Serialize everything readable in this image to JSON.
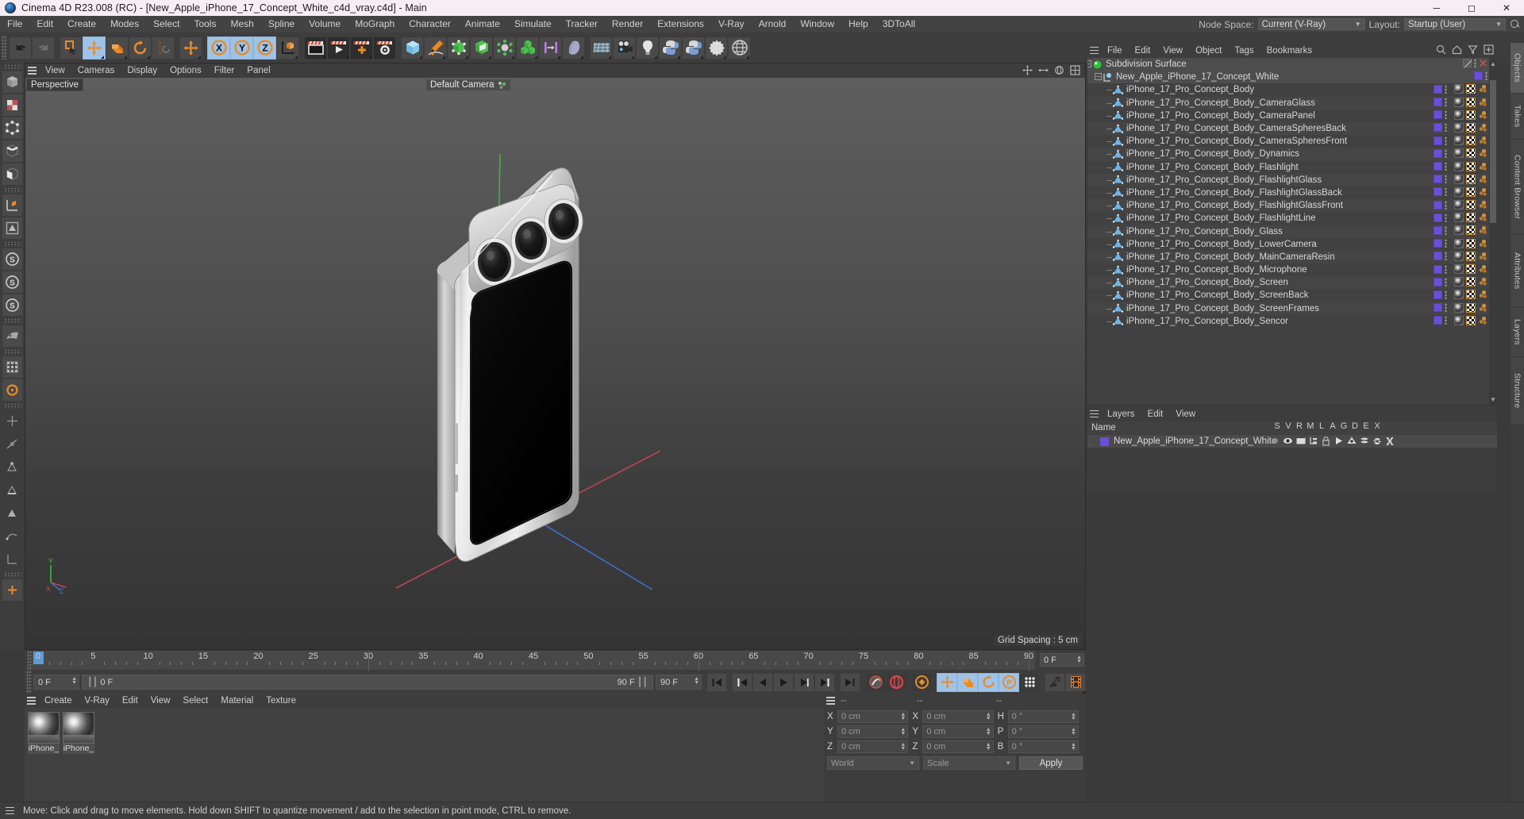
{
  "window": {
    "title": "Cinema 4D R23.008 (RC) - [New_Apple_iPhone_17_Concept_White_c4d_vray.c4d] - Main",
    "app_icon": "cinema4d-logo-icon",
    "minimize": "─",
    "maximize": "☐",
    "close": "✕"
  },
  "menubar": {
    "items": [
      "File",
      "Edit",
      "Create",
      "Modes",
      "Select",
      "Tools",
      "Mesh",
      "Spline",
      "Volume",
      "MoGraph",
      "Character",
      "Animate",
      "Simulate",
      "Tracker",
      "Render",
      "Extensions",
      "V-Ray",
      "Arnold",
      "Window",
      "Help",
      "3DToAll"
    ],
    "node_space_label": "Node Space:",
    "node_space_value": "Current (V-Ray)",
    "layout_label": "Layout:",
    "layout_value": "Startup (User)",
    "search_icon": "search-icon"
  },
  "toolbar": {
    "buttons": [
      {
        "name": "undo-button",
        "icon": "undo-icon",
        "state": "normal"
      },
      {
        "name": "redo-button",
        "icon": "redo-icon",
        "state": "disabled"
      },
      {
        "name": "live-selection-button",
        "icon": "selection-square-icon",
        "state": "normal"
      },
      {
        "name": "move-tool-button",
        "icon": "move-arrows-icon",
        "state": "active"
      },
      {
        "name": "scale-tool-button",
        "icon": "scale-box-icon",
        "state": "normal"
      },
      {
        "name": "rotate-tool-button",
        "icon": "rotate-circle-icon",
        "state": "normal"
      },
      {
        "name": "psr-button",
        "icon": "psr-icon",
        "state": "normal"
      },
      {
        "name": "world-axis-button",
        "icon": "move-arrows-icon",
        "state": "normal"
      },
      {
        "name": "x-axis-lock-button",
        "icon": "axis-x-icon",
        "state": "active"
      },
      {
        "name": "y-axis-lock-button",
        "icon": "axis-y-icon",
        "state": "active"
      },
      {
        "name": "z-axis-lock-button",
        "icon": "axis-z-icon",
        "state": "active"
      },
      {
        "name": "world-object-coord-button",
        "icon": "world-coord-icon",
        "state": "normal"
      },
      {
        "name": "render-view-button",
        "icon": "render-view-icon",
        "state": "dark"
      },
      {
        "name": "render-region-button",
        "icon": "render-region-icon",
        "state": "dark"
      },
      {
        "name": "render-queue-button",
        "icon": "render-queue-icon",
        "state": "dark"
      },
      {
        "name": "render-settings-button",
        "icon": "render-settings-icon",
        "state": "dark"
      },
      {
        "name": "cube-primitive-button",
        "icon": "cube-icon",
        "state": "normal"
      },
      {
        "name": "spline-pen-button",
        "icon": "pen-icon",
        "state": "normal"
      },
      {
        "name": "nurbs-button",
        "icon": "nurbs-icon",
        "state": "normal"
      },
      {
        "name": "array-button",
        "icon": "array-icon",
        "state": "normal"
      },
      {
        "name": "deformer-button",
        "icon": "deformer-icon",
        "state": "normal"
      },
      {
        "name": "mograph-button",
        "icon": "mograph-cubes-icon",
        "state": "normal"
      },
      {
        "name": "field-button",
        "icon": "field-icon",
        "state": "normal"
      },
      {
        "name": "hair-button",
        "icon": "hair-icon",
        "state": "normal"
      },
      {
        "name": "floor-button",
        "icon": "floor-grid-icon",
        "state": "normal"
      },
      {
        "name": "camera-button",
        "icon": "camera-icon",
        "state": "normal"
      },
      {
        "name": "light-button",
        "icon": "light-bulb-icon",
        "state": "normal"
      },
      {
        "name": "python-button",
        "icon": "python-icon",
        "state": "normal"
      },
      {
        "name": "python-generator-button",
        "icon": "python-icon",
        "state": "normal"
      },
      {
        "name": "xpresso-button",
        "icon": "gear-star-icon",
        "state": "normal"
      },
      {
        "name": "web-button",
        "icon": "globe-icon",
        "state": "normal"
      }
    ]
  },
  "left_toolbar": {
    "buttons": [
      {
        "name": "model-mode-button",
        "icon": "model-mode-icon"
      },
      {
        "name": "texture-mode-button",
        "icon": "texture-mode-icon"
      },
      {
        "name": "point-mode-button",
        "icon": "point-mode-icon"
      },
      {
        "name": "edge-mode-button",
        "icon": "edge-mode-icon"
      },
      {
        "name": "polygon-mode-button",
        "icon": "polygon-mode-icon"
      },
      {
        "name": "enable-axis-button",
        "icon": "axis-modify-icon"
      },
      {
        "name": "viewport-solo-button",
        "icon": "viewport-solo-icon"
      },
      {
        "name": "solo-single-button",
        "icon": "solo-single-icon"
      },
      {
        "name": "solo-hierarchy-button",
        "icon": "solo-hierarchy-icon"
      },
      {
        "name": "solo-off-button",
        "icon": "solo-off-icon"
      },
      {
        "name": "workplane-button",
        "icon": "workplane-icon"
      },
      {
        "name": "snap-button",
        "icon": "snap-magnet-icon"
      },
      {
        "name": "quantize-button",
        "icon": "quantize-icon"
      },
      {
        "name": "grid-snap-button",
        "icon": "grid-snap-icon"
      },
      {
        "name": "guide-snap-button",
        "icon": "guide-snap-icon"
      },
      {
        "name": "point-snap-button",
        "icon": "point-snap-icon"
      },
      {
        "name": "edge-snap-button",
        "icon": "edge-snap-icon"
      },
      {
        "name": "poly-snap-button",
        "icon": "poly-snap-icon"
      },
      {
        "name": "spline-snap-button",
        "icon": "spline-snap-icon"
      },
      {
        "name": "axis-snap-button",
        "icon": "axis-snap-icon"
      }
    ]
  },
  "viewport": {
    "menu": [
      "View",
      "Cameras",
      "Display",
      "Options",
      "Filter",
      "Panel"
    ],
    "projection_label": "Perspective",
    "camera_label": "Default Camera",
    "camera_icon": "camera-dots-icon",
    "grid_spacing": "Grid Spacing : 5 cm",
    "axis_labels": {
      "x": "X",
      "y": "Y",
      "z": "Z"
    },
    "nav_icons": [
      "pan-icon",
      "zoom-icon",
      "rotate-icon",
      "maximize-view-icon"
    ],
    "colors": {
      "bg_top": "#5e5e5e",
      "bg_bottom": "#343434",
      "axis_x": "#d0444c",
      "axis_y": "#3ec53e",
      "axis_z": "#4472d8",
      "phone_body": "#d9d9d9",
      "phone_screen": "#050505"
    }
  },
  "timeline": {
    "ticks": [
      0,
      5,
      10,
      15,
      20,
      25,
      30,
      35,
      40,
      45,
      50,
      55,
      60,
      65,
      70,
      75,
      80,
      85,
      90
    ],
    "current_frame_marker": "0",
    "end_field": "0 F"
  },
  "playbar": {
    "current_frame": "0 F",
    "range_start": "0 F",
    "range_end": "90 F",
    "preview_end": "90 F",
    "buttons": [
      {
        "name": "go-to-start-button",
        "icon": "skip-start-icon"
      },
      {
        "name": "go-to-previous-key-button",
        "icon": "prev-key-icon"
      },
      {
        "name": "step-back-button",
        "icon": "step-back-icon"
      },
      {
        "name": "play-button",
        "icon": "play-icon"
      },
      {
        "name": "step-forward-button",
        "icon": "step-forward-icon"
      },
      {
        "name": "go-to-next-key-button",
        "icon": "next-key-icon"
      },
      {
        "name": "go-to-end-button",
        "icon": "skip-end-icon"
      },
      {
        "name": "record-active-objects-button",
        "icon": "record-key-icon"
      },
      {
        "name": "autokeying-button",
        "icon": "autokey-icon"
      },
      {
        "name": "keyframe-selection-button",
        "icon": "keyframe-select-icon"
      },
      {
        "name": "position-key-button",
        "icon": "position-key-icon"
      },
      {
        "name": "scale-key-button",
        "icon": "scale-key-icon"
      },
      {
        "name": "rotation-key-button",
        "icon": "rotation-key-icon"
      },
      {
        "name": "pla-key-button",
        "icon": "pla-key-icon"
      },
      {
        "name": "parameter-key-button",
        "icon": "param-dots-icon"
      },
      {
        "name": "dynamics-button",
        "icon": "dynamics-icon"
      },
      {
        "name": "film-button",
        "icon": "film-strip-icon"
      }
    ]
  },
  "material_manager": {
    "menu": [
      "Create",
      "V-Ray",
      "Edit",
      "View",
      "Select",
      "Material",
      "Texture"
    ],
    "materials": [
      {
        "name": "iPhone_",
        "selected": false
      },
      {
        "name": "iPhone_",
        "selected": false
      }
    ]
  },
  "coordinates": {
    "header": [
      "--",
      "--",
      "--"
    ],
    "position": {
      "label_x": "X",
      "label_y": "Y",
      "label_z": "Z",
      "x": "0 cm",
      "y": "0 cm",
      "z": "0 cm"
    },
    "size": {
      "label_x": "X",
      "label_y": "Y",
      "label_z": "Z",
      "x": "0 cm",
      "y": "0 cm",
      "z": "0 cm"
    },
    "rotation": {
      "label_h": "H",
      "label_p": "P",
      "label_b": "B",
      "h": "0 °",
      "p": "0 °",
      "b": "0 °"
    },
    "coord_system": "World",
    "scale_mode": "Scale",
    "apply_label": "Apply"
  },
  "object_manager": {
    "menu": [
      "File",
      "Edit",
      "View",
      "Object",
      "Tags",
      "Bookmarks"
    ],
    "right_icons": [
      "search-icon",
      "home-icon",
      "filter-icon",
      "expand-icon"
    ],
    "rows": [
      {
        "label": "Subdivision Surface",
        "indent": 0,
        "icon": "subdivision-surface-icon",
        "has_expand": true,
        "tags": [
          "disable-tag",
          "dots",
          "close-x"
        ],
        "selected": true
      },
      {
        "label": "New_Apple_iPhone_17_Concept_White",
        "indent": 1,
        "icon": "null-object-icon",
        "has_expand": true,
        "tags": [
          "layer-swatch",
          "dots"
        ],
        "selected": true
      },
      {
        "label": "iPhone_17_Pro_Concept_Body",
        "indent": 2,
        "icon": "polygon-object-icon",
        "tags": [
          "layer-swatch",
          "dots",
          "material",
          "checker",
          "spheres"
        ]
      },
      {
        "label": "iPhone_17_Pro_Concept_Body_CameraGlass",
        "indent": 2,
        "icon": "polygon-object-icon",
        "tags": [
          "layer-swatch",
          "dots",
          "material",
          "checker",
          "spheres"
        ]
      },
      {
        "label": "iPhone_17_Pro_Concept_Body_CameraPanel",
        "indent": 2,
        "icon": "polygon-object-icon",
        "tags": [
          "layer-swatch",
          "dots",
          "material",
          "checker",
          "spheres"
        ]
      },
      {
        "label": "iPhone_17_Pro_Concept_Body_CameraSpheresBack",
        "indent": 2,
        "icon": "polygon-object-icon",
        "tags": [
          "layer-swatch",
          "dots",
          "material",
          "checker",
          "spheres"
        ]
      },
      {
        "label": "iPhone_17_Pro_Concept_Body_CameraSpheresFront",
        "indent": 2,
        "icon": "polygon-object-icon",
        "tags": [
          "layer-swatch",
          "dots",
          "material",
          "checker",
          "spheres"
        ]
      },
      {
        "label": "iPhone_17_Pro_Concept_Body_Dynamics",
        "indent": 2,
        "icon": "polygon-object-icon",
        "tags": [
          "layer-swatch",
          "dots",
          "material",
          "checker",
          "spheres"
        ]
      },
      {
        "label": "iPhone_17_Pro_Concept_Body_Flashlight",
        "indent": 2,
        "icon": "polygon-object-icon",
        "tags": [
          "layer-swatch",
          "dots",
          "material",
          "checker",
          "spheres"
        ]
      },
      {
        "label": "iPhone_17_Pro_Concept_Body_FlashlightGlass",
        "indent": 2,
        "icon": "polygon-object-icon",
        "tags": [
          "layer-swatch",
          "dots",
          "material",
          "checker",
          "spheres"
        ]
      },
      {
        "label": "iPhone_17_Pro_Concept_Body_FlashlightGlassBack",
        "indent": 2,
        "icon": "polygon-object-icon",
        "tags": [
          "layer-swatch",
          "dots",
          "material",
          "checker",
          "spheres"
        ]
      },
      {
        "label": "iPhone_17_Pro_Concept_Body_FlashlightGlassFront",
        "indent": 2,
        "icon": "polygon-object-icon",
        "tags": [
          "layer-swatch",
          "dots",
          "material",
          "checker",
          "spheres"
        ]
      },
      {
        "label": "iPhone_17_Pro_Concept_Body_FlashlightLine",
        "indent": 2,
        "icon": "polygon-object-icon",
        "tags": [
          "layer-swatch",
          "dots",
          "material",
          "checker",
          "spheres"
        ]
      },
      {
        "label": "iPhone_17_Pro_Concept_Body_Glass",
        "indent": 2,
        "icon": "polygon-object-icon",
        "tags": [
          "layer-swatch",
          "dots",
          "material",
          "checker",
          "spheres"
        ]
      },
      {
        "label": "iPhone_17_Pro_Concept_Body_LowerCamera",
        "indent": 2,
        "icon": "polygon-object-icon",
        "tags": [
          "layer-swatch",
          "dots",
          "material",
          "checker",
          "spheres"
        ]
      },
      {
        "label": "iPhone_17_Pro_Concept_Body_MainCameraResin",
        "indent": 2,
        "icon": "polygon-object-icon",
        "tags": [
          "layer-swatch",
          "dots",
          "material",
          "checker",
          "spheres"
        ]
      },
      {
        "label": "iPhone_17_Pro_Concept_Body_Microphone",
        "indent": 2,
        "icon": "polygon-object-icon",
        "tags": [
          "layer-swatch",
          "dots",
          "material",
          "checker",
          "spheres"
        ]
      },
      {
        "label": "iPhone_17_Pro_Concept_Body_Screen",
        "indent": 2,
        "icon": "polygon-object-icon",
        "tags": [
          "layer-swatch",
          "dots",
          "material",
          "checker",
          "spheres"
        ]
      },
      {
        "label": "iPhone_17_Pro_Concept_Body_ScreenBack",
        "indent": 2,
        "icon": "polygon-object-icon",
        "tags": [
          "layer-swatch",
          "dots",
          "material",
          "checker",
          "spheres"
        ]
      },
      {
        "label": "iPhone_17_Pro_Concept_Body_ScreenFrames",
        "indent": 2,
        "icon": "polygon-object-icon",
        "tags": [
          "layer-swatch",
          "dots",
          "material",
          "checker",
          "spheres"
        ]
      },
      {
        "label": "iPhone_17_Pro_Concept_Body_Sencor",
        "indent": 2,
        "icon": "polygon-object-icon",
        "tags": [
          "layer-swatch",
          "dots",
          "material",
          "checker",
          "spheres"
        ]
      }
    ]
  },
  "layers_manager": {
    "menu": [
      "Layers",
      "Edit",
      "View"
    ],
    "name_header": "Name",
    "columns": [
      "S",
      "V",
      "R",
      "M",
      "L",
      "A",
      "G",
      "D",
      "E",
      "X"
    ],
    "rows": [
      {
        "label": "New_Apple_iPhone_17_Concept_White",
        "swatch": "#6a4fd8"
      }
    ]
  },
  "right_tabs": [
    {
      "label": "Objects",
      "active": true
    },
    {
      "label": "Takes",
      "active": false
    },
    {
      "label": "Content Browser",
      "active": false
    },
    {
      "label": "Attributes",
      "active": false
    },
    {
      "label": "Layers",
      "active": false
    },
    {
      "label": "Structure",
      "active": false
    }
  ],
  "statusbar": {
    "text": "Move: Click and drag to move elements. Hold down SHIFT to quantize movement / add to the selection in point mode, CTRL to remove."
  }
}
